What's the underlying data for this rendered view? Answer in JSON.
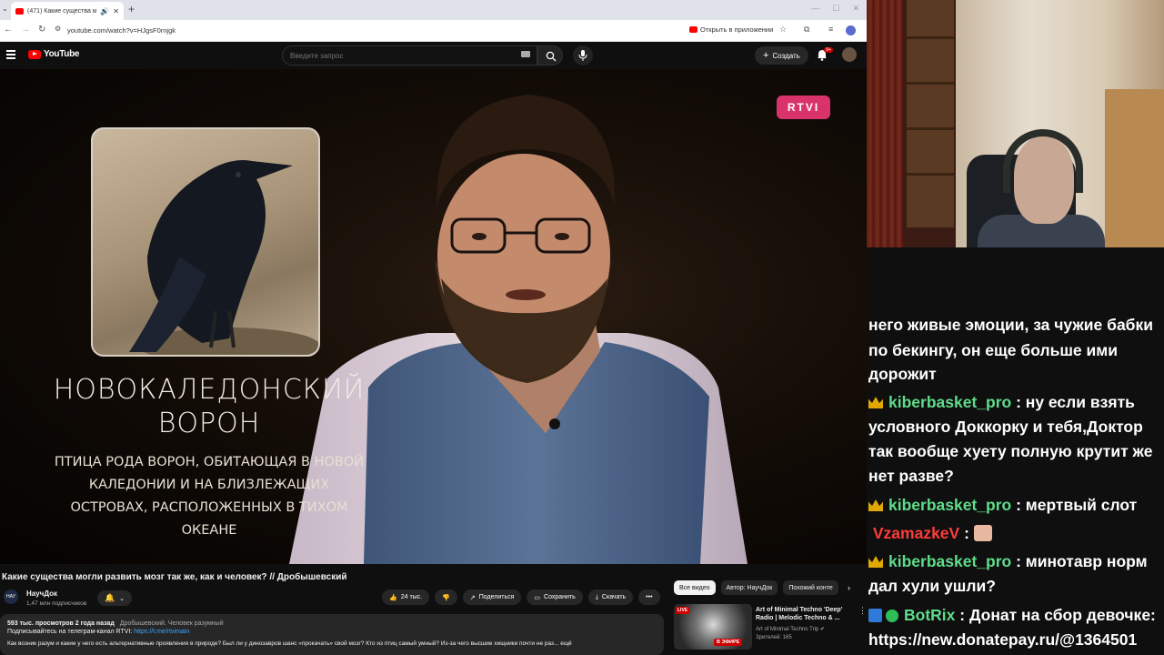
{
  "browser": {
    "tab_title": "(471) Какие существа могл",
    "url": "youtube.com/watch?v=HJgsF0rnjgk",
    "open_in_app": "Открыть в приложении"
  },
  "youtube": {
    "logo_text": "YouTube",
    "search_placeholder": "Введите запрос",
    "create_label": "Создать",
    "notif_count": "9+"
  },
  "video": {
    "channel_badge": "RTVI",
    "overlay_title": "НОВОКАЛЕДОНСКИЙ ВОРОН",
    "overlay_desc": "ПТИЦА РОДА ВОРОН, ОБИТАЮЩАЯ В НОВОЙ КАЛЕДОНИИ И НА БЛИЗЛЕЖАЩИХ ОСТРОВАХ, РАСПОЛОЖЕННЫХ В ТИХОМ ОКЕАНЕ"
  },
  "below": {
    "title": "Какие существа могли развить мозг так же, как и человек? // Дробышевский",
    "channel_name": "НаучДок",
    "channel_avatar_text": "НАУ",
    "subscribers": "1,47 млн подписчиков",
    "likes": "24 тыс.",
    "share": "Поделиться",
    "save": "Сохранить",
    "download": "Скачать",
    "more": "•••",
    "views_date": "593 тыс. просмотров  2 года назад",
    "tags": "Дробышевский. Человек разумный",
    "desc_line2_prefix": "Подписывайтесь на телеграм-канал RTVI: ",
    "desc_link": "https://t.me/rtvimain",
    "desc_line3": "Как возник разум и какие у него есть альтернативные проявления в природе? Был ли у динозавров шанс «прокачать» свой мозг? Кто из птиц самый умный? Из-за чего высшие хищники почти не раз... ещё"
  },
  "sidebar": {
    "chips": [
      "Все видео",
      "Автор: НаучДок",
      "Похожий конте"
    ],
    "rec": {
      "title": "Art of Minimal Techno 'Deep' Radio | Melodic Techno & ...",
      "channel": "Art of Minimal Techno Trip",
      "viewers": "Зрителей: 165",
      "live_badge": "LIVE",
      "efir_badge": "В ЭФИРЕ"
    }
  },
  "chat": {
    "messages": [
      {
        "text": "него живые эмоции, за чужие бабки"
      },
      {
        "text": "по бекингу, он еще больше ими"
      },
      {
        "text": "дорожит"
      },
      {
        "user": "kiberbasket_pro",
        "text": ": ну если взять"
      },
      {
        "text": "условного Доккорку и тебя,Доктор"
      },
      {
        "text": "так вообще хуету полную крутит же"
      },
      {
        "text": "нет разве?"
      },
      {
        "user": "kiberbasket_pro",
        "text": ": мертвый слот"
      },
      {
        "user": "VzamazkeV",
        "text": ":"
      },
      {
        "user": "kiberbasket_pro",
        "text": ": минотавр норм"
      },
      {
        "text": "дал хули ушли?"
      },
      {
        "user": "BotRix",
        "text": ": Донат на сбор девочке:"
      },
      {
        "text": "https://new.donatepay.ru/@1364501"
      }
    ]
  },
  "colors": {
    "yt_red": "#ff0000",
    "rtvi_pink": "#d8336a",
    "chat_green": "#5edc8a",
    "chat_red": "#ff3b3b"
  }
}
